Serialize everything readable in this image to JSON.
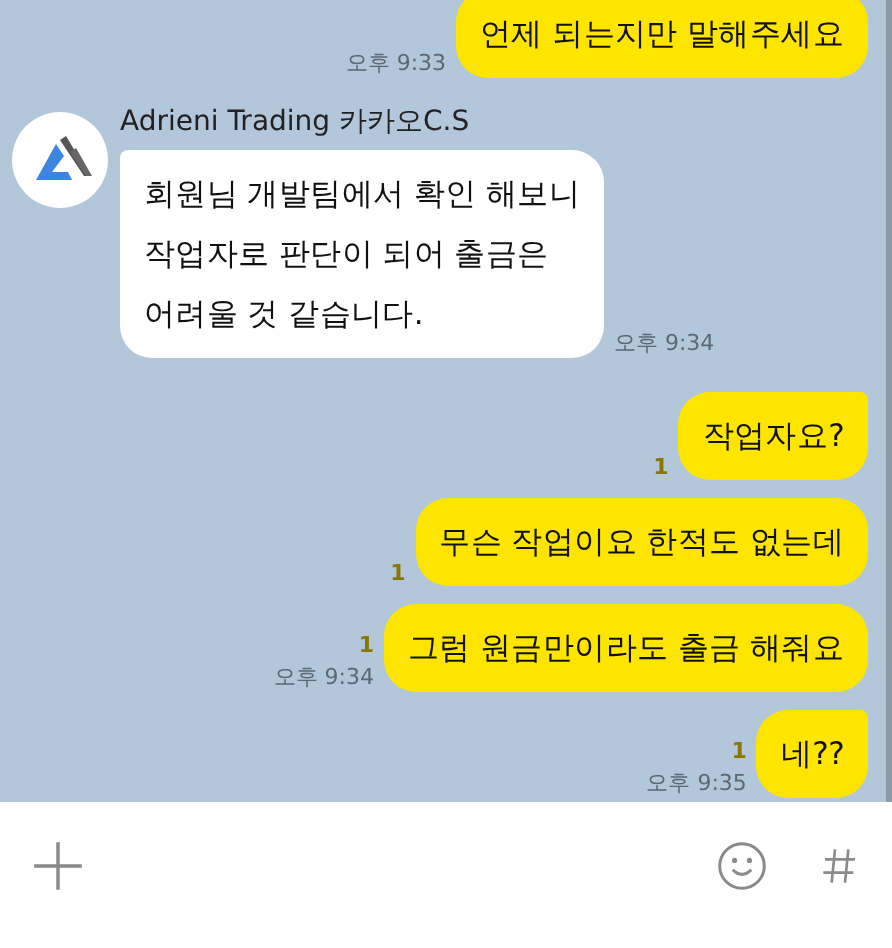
{
  "messages": [
    {
      "kind": "sent",
      "text": "언제 되는지만 말해주세요",
      "time": "오후 9:33"
    },
    {
      "kind": "received",
      "sender": "Adrieni Trading 카카오C.S",
      "text": "회원님 개발팀에서 확인 해보니\n작업자로 판단이 되어 출금은\n어려울 것 같습니다.",
      "time": "오후 9:34",
      "tail": true
    },
    {
      "kind": "sent",
      "text": "작업자요?",
      "unread": "1",
      "tail": true
    },
    {
      "kind": "sent",
      "text": "무슨 작업이요 한적도 없는데",
      "unread": "1",
      "tail": false
    },
    {
      "kind": "sent",
      "text": "그럼 원금만이라도 출금 해줘요",
      "unread": "1",
      "time": "오후 9:34",
      "tail": false
    },
    {
      "kind": "sent",
      "text": "네??",
      "unread": "1",
      "time": "오후 9:35",
      "tail": true
    }
  ]
}
